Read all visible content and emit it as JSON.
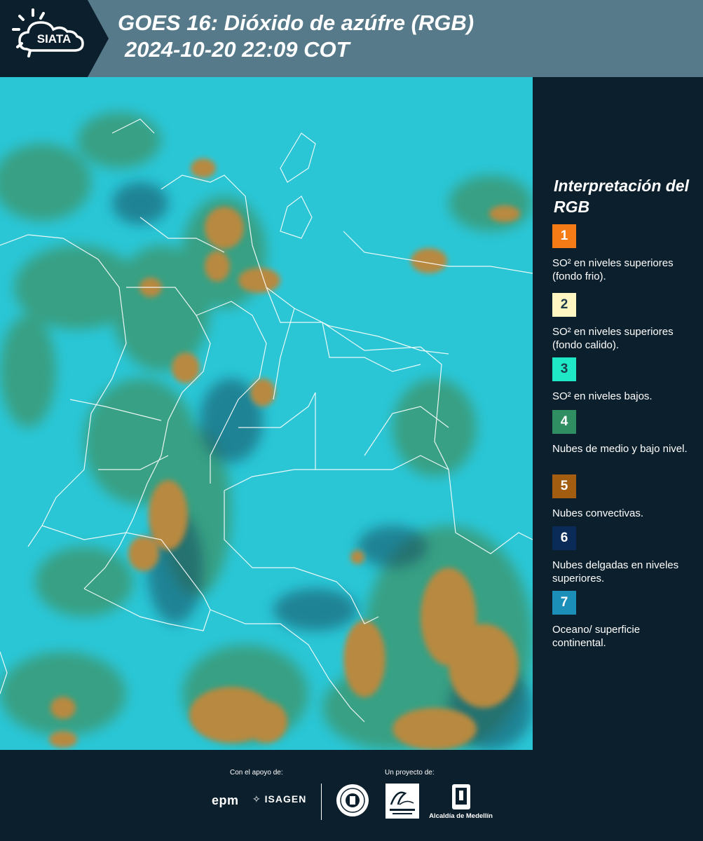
{
  "header": {
    "logo_text": "SIATA",
    "title_line1": "GOES 16: Dióxido de azúfre (RGB)",
    "title_line2": "2024-10-20 22:09 COT"
  },
  "legend": {
    "title": "Interpretación del RGB",
    "items": [
      {
        "number": "1",
        "color": "#f47b16",
        "label": "SO² en niveles superiores (fondo frio)."
      },
      {
        "number": "2",
        "color": "#fff6c2",
        "label": "SO² en niveles superiores (fondo calido)."
      },
      {
        "number": "3",
        "color": "#1ee8c6",
        "label": "SO² en niveles bajos."
      },
      {
        "number": "4",
        "color": "#2f8f63",
        "label": "Nubes de medio y bajo nivel."
      },
      {
        "number": "5",
        "color": "#a35d10",
        "label": "Nubes convectivas."
      },
      {
        "number": "6",
        "color": "#0a2a57",
        "label": "Nubes delgadas en niveles superiores."
      },
      {
        "number": "7",
        "color": "#1c8fb8",
        "label": "Oceano/ superficie continental."
      }
    ]
  },
  "footer": {
    "support_caption": "Con el apoyo de:",
    "project_caption": "Un proyecto de:",
    "sponsor_epm": "epm",
    "sponsor_isagen": "ISAGEN",
    "partner_alcaldia": "Alcaldía de Medellín"
  },
  "map_colors": {
    "ocean": "#29c4d4",
    "convective": "#b9873e",
    "mid_low_cloud": "#3d9a78",
    "thin_cloud": "#1a5566",
    "border": "#ffffff"
  }
}
